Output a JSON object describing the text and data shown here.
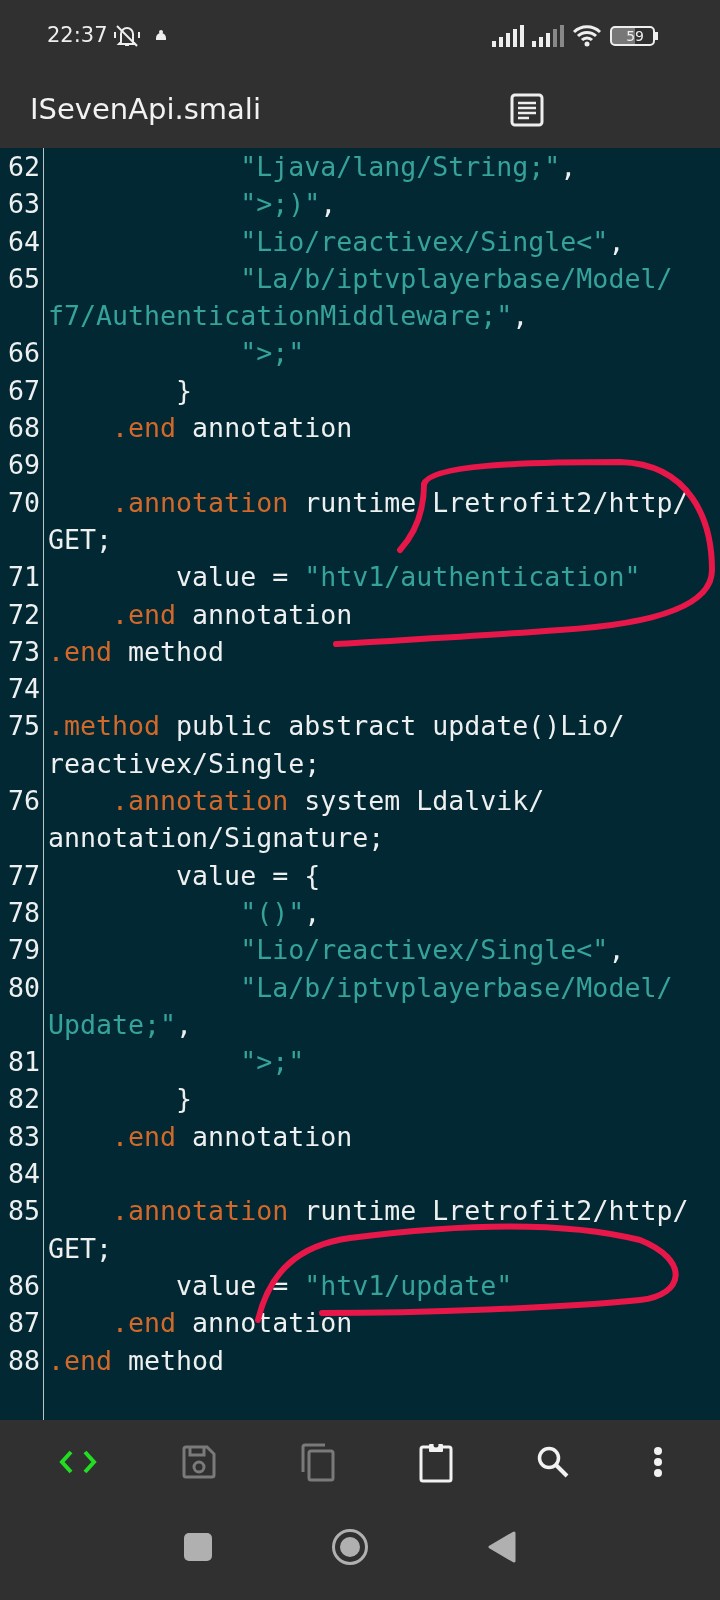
{
  "status_bar": {
    "time": "22:37",
    "battery": "59"
  },
  "title_bar": {
    "title": "ISevenApi.smali"
  },
  "code_lines": [
    {
      "number": "62",
      "tokens": [
        {
          "kind": "string",
          "text": "            \"Ljava/lang/String;\""
        },
        {
          "kind": "plain",
          "text": ","
        }
      ]
    },
    {
      "number": "63",
      "tokens": [
        {
          "kind": "string",
          "text": "            \">;)\""
        },
        {
          "kind": "plain",
          "text": ","
        }
      ]
    },
    {
      "number": "64",
      "tokens": [
        {
          "kind": "string",
          "text": "            \"Lio/reactivex/Single<\""
        },
        {
          "kind": "plain",
          "text": ","
        }
      ]
    },
    {
      "number": "65",
      "tokens": [
        {
          "kind": "string",
          "text": "            \"La/b/iptvplayerbase/Model/"
        },
        {
          "kind": "break"
        },
        {
          "kind": "string",
          "text": "f7/AuthenticationMiddleware;\""
        },
        {
          "kind": "plain",
          "text": ","
        }
      ]
    },
    {
      "number": "66",
      "tokens": [
        {
          "kind": "string",
          "text": "            \">;\""
        }
      ]
    },
    {
      "number": "67",
      "tokens": [
        {
          "kind": "plain",
          "text": "        }"
        }
      ]
    },
    {
      "number": "68",
      "tokens": [
        {
          "kind": "keyword",
          "text": "    .end"
        },
        {
          "kind": "plain",
          "text": " annotation"
        }
      ]
    },
    {
      "number": "69"
    },
    {
      "number": "70",
      "tokens": [
        {
          "kind": "keyword",
          "text": "    .annotation"
        },
        {
          "kind": "plain",
          "text": " runtime Lretrofit2/http/"
        },
        {
          "kind": "break"
        },
        {
          "kind": "plain",
          "text": "GET;"
        }
      ]
    },
    {
      "number": "71",
      "tokens": [
        {
          "kind": "plain",
          "text": "        value = "
        },
        {
          "kind": "string",
          "text": "\"htv1/authentication\""
        }
      ]
    },
    {
      "number": "72",
      "tokens": [
        {
          "kind": "keyword",
          "text": "    .end"
        },
        {
          "kind": "plain",
          "text": " annotation"
        }
      ]
    },
    {
      "number": "73",
      "tokens": [
        {
          "kind": "keyword",
          "text": ".end"
        },
        {
          "kind": "plain",
          "text": " method"
        }
      ]
    },
    {
      "number": "74"
    },
    {
      "number": "75",
      "tokens": [
        {
          "kind": "keyword",
          "text": ".method"
        },
        {
          "kind": "plain",
          "text": " public abstract update()Lio/"
        },
        {
          "kind": "break"
        },
        {
          "kind": "plain",
          "text": "reactivex/Single;"
        }
      ]
    },
    {
      "number": "76",
      "tokens": [
        {
          "kind": "keyword",
          "text": "    .annotation"
        },
        {
          "kind": "plain",
          "text": " system Ldalvik/"
        },
        {
          "kind": "break"
        },
        {
          "kind": "plain",
          "text": "annotation/Signature;"
        }
      ]
    },
    {
      "number": "77",
      "tokens": [
        {
          "kind": "plain",
          "text": "        value = {"
        }
      ]
    },
    {
      "number": "78",
      "tokens": [
        {
          "kind": "string",
          "text": "            \"()\""
        },
        {
          "kind": "plain",
          "text": ","
        }
      ]
    },
    {
      "number": "79",
      "tokens": [
        {
          "kind": "string",
          "text": "            \"Lio/reactivex/Single<\""
        },
        {
          "kind": "plain",
          "text": ","
        }
      ]
    },
    {
      "number": "80",
      "tokens": [
        {
          "kind": "string",
          "text": "            \"La/b/iptvplayerbase/Model/"
        },
        {
          "kind": "break"
        },
        {
          "kind": "string",
          "text": "Update;\""
        },
        {
          "kind": "plain",
          "text": ","
        }
      ]
    },
    {
      "number": "81",
      "tokens": [
        {
          "kind": "string",
          "text": "            \">;\""
        }
      ]
    },
    {
      "number": "82",
      "tokens": [
        {
          "kind": "plain",
          "text": "        }"
        }
      ]
    },
    {
      "number": "83",
      "tokens": [
        {
          "kind": "keyword",
          "text": "    .end"
        },
        {
          "kind": "plain",
          "text": " annotation"
        }
      ]
    },
    {
      "number": "84"
    },
    {
      "number": "85",
      "tokens": [
        {
          "kind": "keyword",
          "text": "    .annotation"
        },
        {
          "kind": "plain",
          "text": " runtime Lretrofit2/http/"
        },
        {
          "kind": "break"
        },
        {
          "kind": "plain",
          "text": "GET;"
        }
      ]
    },
    {
      "number": "86",
      "tokens": [
        {
          "kind": "plain",
          "text": "        value = "
        },
        {
          "kind": "string",
          "text": "\"htv1/update\""
        }
      ]
    },
    {
      "number": "87",
      "tokens": [
        {
          "kind": "keyword",
          "text": "    .end"
        },
        {
          "kind": "plain",
          "text": " annotation"
        }
      ]
    },
    {
      "number": "88",
      "tokens": [
        {
          "kind": "keyword",
          "text": ".end"
        },
        {
          "kind": "plain",
          "text": " method"
        }
      ]
    }
  ],
  "toolbar": [
    {
      "kind": "code",
      "disabled": false,
      "selected": true
    },
    {
      "kind": "save",
      "disabled": true,
      "selected": false
    },
    {
      "kind": "copy",
      "disabled": true,
      "selected": false
    },
    {
      "kind": "paste",
      "disabled": false,
      "selected": false
    },
    {
      "kind": "search",
      "disabled": false,
      "selected": false
    },
    {
      "kind": "more",
      "disabled": false,
      "selected": false
    }
  ],
  "nav_bar": [
    {
      "kind": "recents"
    },
    {
      "kind": "home"
    },
    {
      "kind": "back"
    }
  ]
}
